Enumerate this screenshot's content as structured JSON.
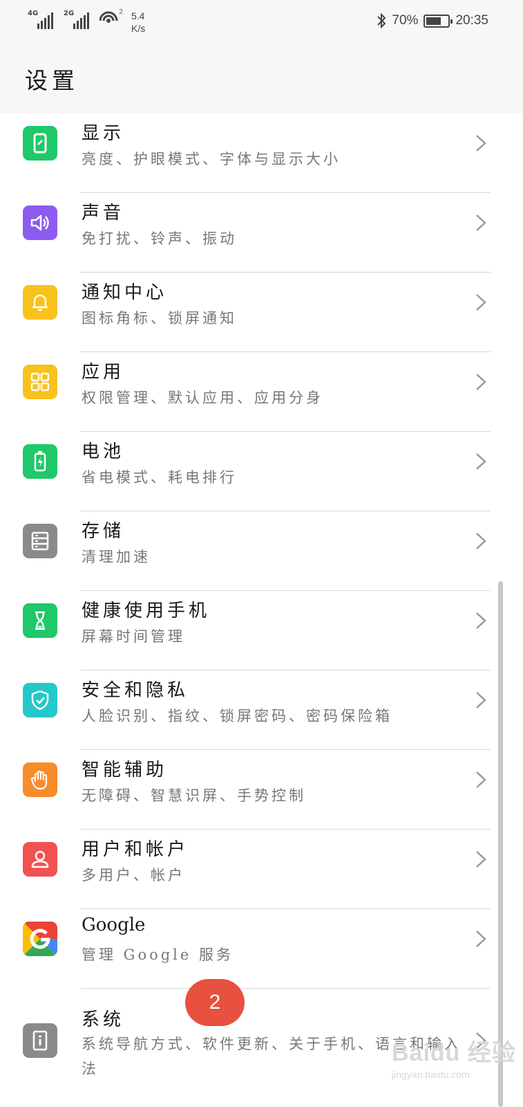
{
  "status_bar": {
    "net1_tag": "4G",
    "net2_tag": "2G",
    "wifi_badge": "2",
    "speed_value": "5.4",
    "speed_unit": "K/s",
    "battery_percent": "70%",
    "battery_level": 0.7,
    "time": "20:35"
  },
  "header": {
    "title": "设置"
  },
  "settings": [
    {
      "title": "显示",
      "subtitle": "亮度、护眼模式、字体与显示大小",
      "icon": "display-icon",
      "color": "#1fc86a"
    },
    {
      "title": "声音",
      "subtitle": "免打扰、铃声、振动",
      "icon": "sound-icon",
      "color": "#8c5cf0"
    },
    {
      "title": "通知中心",
      "subtitle": "图标角标、锁屏通知",
      "icon": "bell-icon",
      "color": "#f7c21b"
    },
    {
      "title": "应用",
      "subtitle": "权限管理、默认应用、应用分身",
      "icon": "apps-grid-icon",
      "color": "#f7c21b"
    },
    {
      "title": "电池",
      "subtitle": "省电模式、耗电排行",
      "icon": "battery-icon",
      "color": "#1fc86a"
    },
    {
      "title": "存储",
      "subtitle": "清理加速",
      "icon": "storage-icon",
      "color": "#8a8a8a"
    },
    {
      "title": "健康使用手机",
      "subtitle": "屏幕时间管理",
      "icon": "hourglass-icon",
      "color": "#1fc86a"
    },
    {
      "title": "安全和隐私",
      "subtitle": "人脸识别、指纹、锁屏密码、密码保险箱",
      "icon": "shield-icon",
      "color": "#25c8c8"
    },
    {
      "title": "智能辅助",
      "subtitle": "无障碍、智慧识屏、手势控制",
      "icon": "hand-icon",
      "color": "#f78c2a"
    },
    {
      "title": "用户和帐户",
      "subtitle": "多用户、帐户",
      "icon": "user-icon",
      "color": "#f05252"
    },
    {
      "title": "Google",
      "subtitle": "管理 Google 服务",
      "icon": "google-icon",
      "color": "#ffffff"
    },
    {
      "title": "系统",
      "subtitle": "系统导航方式、软件更新、关于手机、语言和输入法",
      "icon": "system-info-icon",
      "color": "#8a8a8a"
    }
  ],
  "step_badge": "2",
  "watermark": {
    "main": "Baidu 经验",
    "sub": "jingyan.baidu.com"
  }
}
